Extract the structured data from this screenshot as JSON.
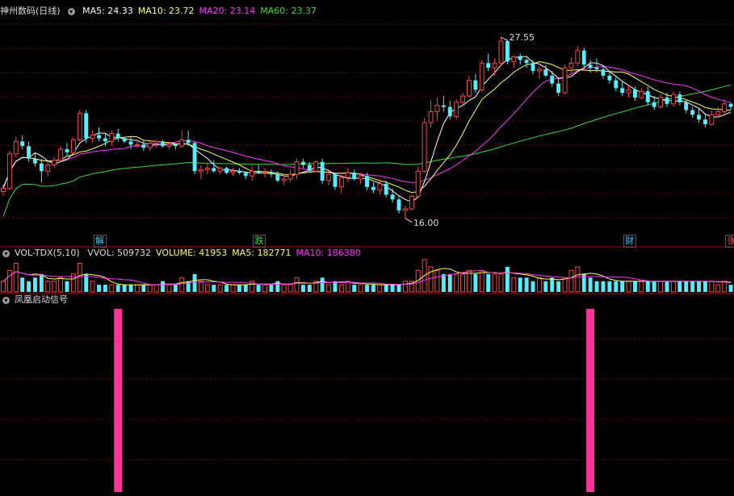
{
  "header": {
    "stock": "神州数码(日线)",
    "indicators": [
      {
        "label": "MA5: 24.33",
        "color": "#ffffff"
      },
      {
        "label": "MA10: 23.72",
        "color": "#ffff55"
      },
      {
        "label": "MA20: 23.14",
        "color": "#ff33ff"
      },
      {
        "label": "MA60: 23.37",
        "color": "#33dd33"
      }
    ]
  },
  "volume_header": {
    "title": "VOL-TDX(5,10)",
    "items": [
      {
        "label": "VVOL: 509732",
        "color": "#dddddd"
      },
      {
        "label": "VOLUME: 41953",
        "color": "#ffff55"
      },
      {
        "label": "MA5: 182771",
        "color": "#ffff55"
      },
      {
        "label": "MA10: 186380",
        "color": "#ff33ff"
      }
    ]
  },
  "signal_header": {
    "title": "凤凰启动信号"
  },
  "events": [
    {
      "label": "解",
      "color": "#33ccff",
      "index": 15
    },
    {
      "label": "跌",
      "color": "#33dd33",
      "index": 40
    },
    {
      "label": "财",
      "color": "#33ccff",
      "index": 98
    },
    {
      "label": "张",
      "color": "#ff5555",
      "index": 114
    }
  ],
  "annotations": {
    "high": "27.55",
    "low": "16.00"
  },
  "colors": {
    "up": "#ff4444",
    "down": "#55eeff",
    "signal": "#ff3399",
    "grid": "#7a0000"
  },
  "chart_data": {
    "type": "candlestick",
    "price_range": [
      15.0,
      29.0
    ],
    "ohlc": [
      [
        17.7,
        18.2,
        17.4,
        17.9
      ],
      [
        17.9,
        20.3,
        17.8,
        20.1
      ],
      [
        20.1,
        21.2,
        19.9,
        20.9
      ],
      [
        20.9,
        21.3,
        20.4,
        20.6
      ],
      [
        20.6,
        20.9,
        19.6,
        19.8
      ],
      [
        19.8,
        20.2,
        19.3,
        19.5
      ],
      [
        19.5,
        19.8,
        18.3,
        19.0
      ],
      [
        19.0,
        19.6,
        18.7,
        19.4
      ],
      [
        19.4,
        19.9,
        19.2,
        19.7
      ],
      [
        19.7,
        20.6,
        19.6,
        20.4
      ],
      [
        20.4,
        20.8,
        20.0,
        20.2
      ],
      [
        20.2,
        21.2,
        20.0,
        21.0
      ],
      [
        21.0,
        22.9,
        20.9,
        22.7
      ],
      [
        22.7,
        22.9,
        20.8,
        21.1
      ],
      [
        21.1,
        21.6,
        20.8,
        21.3
      ],
      [
        21.3,
        21.8,
        20.9,
        21.1
      ],
      [
        21.1,
        21.4,
        20.6,
        20.9
      ],
      [
        20.9,
        21.6,
        20.6,
        21.4
      ],
      [
        21.4,
        21.7,
        20.9,
        21.1
      ],
      [
        21.1,
        21.2,
        20.8,
        20.9
      ],
      [
        20.9,
        21.2,
        20.4,
        20.7
      ],
      [
        20.7,
        20.9,
        20.5,
        20.7
      ],
      [
        20.7,
        21.0,
        20.3,
        20.5
      ],
      [
        20.5,
        21.0,
        20.3,
        20.8
      ],
      [
        20.8,
        21.0,
        20.5,
        20.9
      ],
      [
        20.9,
        21.0,
        20.5,
        20.6
      ],
      [
        20.6,
        20.8,
        20.4,
        20.7
      ],
      [
        20.7,
        20.8,
        20.4,
        20.6
      ],
      [
        20.6,
        21.6,
        20.5,
        21.0
      ],
      [
        21.0,
        21.6,
        20.6,
        20.8
      ],
      [
        20.8,
        20.9,
        18.8,
        19.0
      ],
      [
        19.0,
        19.4,
        18.5,
        19.1
      ],
      [
        19.1,
        19.5,
        18.8,
        19.2
      ],
      [
        19.2,
        19.7,
        18.9,
        19.0
      ],
      [
        19.0,
        19.3,
        18.8,
        19.2
      ],
      [
        19.2,
        19.3,
        18.8,
        18.9
      ],
      [
        18.9,
        19.2,
        18.7,
        19.0
      ],
      [
        19.0,
        19.2,
        18.8,
        18.9
      ],
      [
        18.9,
        19.0,
        18.5,
        18.7
      ],
      [
        18.7,
        19.3,
        18.4,
        19.0
      ],
      [
        19.0,
        19.4,
        18.8,
        18.9
      ],
      [
        18.9,
        19.2,
        18.6,
        18.9
      ],
      [
        18.9,
        19.1,
        18.6,
        18.8
      ],
      [
        18.8,
        19.0,
        18.3,
        18.4
      ],
      [
        18.4,
        18.7,
        18.1,
        18.5
      ],
      [
        18.5,
        19.1,
        18.3,
        18.8
      ],
      [
        18.8,
        19.8,
        18.5,
        19.6
      ],
      [
        19.6,
        19.8,
        19.2,
        19.4
      ],
      [
        19.4,
        19.6,
        18.9,
        19.0
      ],
      [
        19.0,
        19.7,
        18.9,
        19.6
      ],
      [
        19.6,
        19.8,
        18.2,
        18.4
      ],
      [
        18.4,
        18.9,
        18.1,
        18.8
      ],
      [
        18.8,
        18.9,
        17.8,
        18.0
      ],
      [
        18.0,
        18.8,
        17.6,
        18.6
      ],
      [
        18.6,
        19.2,
        18.3,
        18.9
      ],
      [
        18.9,
        19.1,
        18.4,
        18.5
      ],
      [
        18.5,
        18.9,
        18.2,
        18.7
      ],
      [
        18.7,
        18.9,
        17.8,
        18.0
      ],
      [
        18.0,
        18.3,
        17.6,
        17.8
      ],
      [
        17.8,
        18.5,
        17.5,
        18.2
      ],
      [
        18.2,
        18.4,
        17.3,
        17.5
      ],
      [
        17.5,
        17.9,
        17.0,
        17.2
      ],
      [
        17.2,
        17.4,
        16.3,
        16.5
      ],
      [
        16.5,
        16.8,
        16.0,
        16.6
      ],
      [
        16.6,
        17.5,
        16.5,
        17.4
      ],
      [
        17.4,
        19.3,
        17.3,
        19.0
      ],
      [
        19.0,
        22.4,
        18.9,
        22.1
      ],
      [
        22.1,
        23.5,
        21.8,
        22.8
      ],
      [
        22.8,
        23.7,
        22.2,
        23.2
      ],
      [
        23.2,
        23.8,
        22.8,
        23.1
      ],
      [
        23.1,
        23.5,
        22.3,
        22.5
      ],
      [
        22.5,
        23.6,
        22.3,
        23.4
      ],
      [
        23.4,
        24.0,
        23.2,
        23.8
      ],
      [
        23.8,
        25.1,
        23.7,
        24.8
      ],
      [
        24.8,
        25.2,
        24.0,
        24.2
      ],
      [
        24.2,
        26.1,
        24.1,
        25.9
      ],
      [
        25.9,
        26.5,
        25.4,
        25.6
      ],
      [
        25.6,
        26.2,
        25.1,
        25.9
      ],
      [
        25.9,
        27.55,
        25.7,
        27.3
      ],
      [
        27.3,
        27.4,
        25.8,
        26.0
      ],
      [
        26.0,
        26.4,
        25.6,
        26.3
      ],
      [
        26.3,
        26.5,
        25.8,
        26.1
      ],
      [
        26.1,
        26.2,
        25.6,
        25.9
      ],
      [
        25.9,
        26.1,
        25.2,
        25.4
      ],
      [
        25.4,
        25.7,
        24.9,
        25.5
      ],
      [
        25.5,
        25.8,
        25.0,
        25.1
      ],
      [
        25.1,
        25.4,
        24.4,
        24.6
      ],
      [
        24.6,
        24.9,
        23.8,
        24.0
      ],
      [
        24.0,
        25.8,
        23.9,
        25.6
      ],
      [
        25.6,
        26.3,
        25.2,
        25.9
      ],
      [
        25.9,
        27.0,
        25.7,
        26.7
      ],
      [
        26.7,
        26.9,
        25.6,
        25.8
      ],
      [
        25.8,
        26.1,
        25.3,
        25.6
      ],
      [
        25.6,
        26.2,
        25.3,
        25.5
      ],
      [
        25.5,
        25.7,
        24.9,
        25.1
      ],
      [
        25.1,
        25.4,
        24.6,
        24.8
      ],
      [
        24.8,
        25.0,
        24.1,
        24.3
      ],
      [
        24.3,
        24.7,
        23.8,
        24.0
      ],
      [
        24.0,
        24.5,
        23.7,
        24.2
      ],
      [
        24.2,
        24.4,
        23.5,
        23.7
      ],
      [
        23.7,
        24.3,
        23.6,
        24.1
      ],
      [
        24.1,
        24.4,
        23.2,
        23.4
      ],
      [
        23.4,
        23.8,
        22.9,
        23.1
      ],
      [
        23.1,
        23.9,
        23.0,
        23.7
      ],
      [
        23.7,
        24.0,
        23.1,
        23.3
      ],
      [
        23.3,
        24.1,
        23.1,
        23.9
      ],
      [
        23.9,
        24.1,
        23.2,
        23.4
      ],
      [
        23.4,
        23.6,
        22.7,
        22.9
      ],
      [
        22.9,
        23.1,
        22.4,
        22.6
      ],
      [
        22.6,
        23.0,
        22.1,
        22.3
      ],
      [
        22.3,
        22.7,
        21.8,
        22.0
      ],
      [
        22.0,
        22.9,
        21.9,
        22.6
      ],
      [
        22.6,
        23.1,
        22.4,
        22.8
      ],
      [
        22.8,
        23.6,
        22.5,
        23.3
      ],
      [
        23.3,
        23.4,
        22.9,
        23.1
      ]
    ],
    "volume": [
      3,
      6,
      8,
      4,
      3,
      4,
      5,
      3,
      3,
      4,
      3,
      5,
      8,
      5,
      3,
      2,
      2,
      2,
      2,
      2,
      2,
      2,
      2,
      2,
      2,
      3,
      2,
      2,
      4,
      3,
      5,
      3,
      2,
      2,
      2,
      2,
      2,
      2,
      2,
      3,
      2,
      2,
      2,
      3,
      2,
      2,
      4,
      2,
      2,
      3,
      4,
      2,
      3,
      2,
      3,
      2,
      2,
      2,
      2,
      2,
      2,
      2,
      2,
      3,
      3,
      6,
      9,
      7,
      6,
      5,
      5,
      5,
      5,
      6,
      5,
      6,
      5,
      5,
      5,
      7,
      4,
      4,
      4,
      3,
      4,
      3,
      4,
      3,
      4,
      6,
      7,
      5,
      4,
      3,
      3,
      3,
      3,
      3,
      3,
      3,
      3,
      3,
      3,
      3,
      3,
      3,
      3,
      3,
      3,
      3,
      3,
      3,
      2,
      3,
      2
    ],
    "signals": [
      18,
      92
    ]
  }
}
